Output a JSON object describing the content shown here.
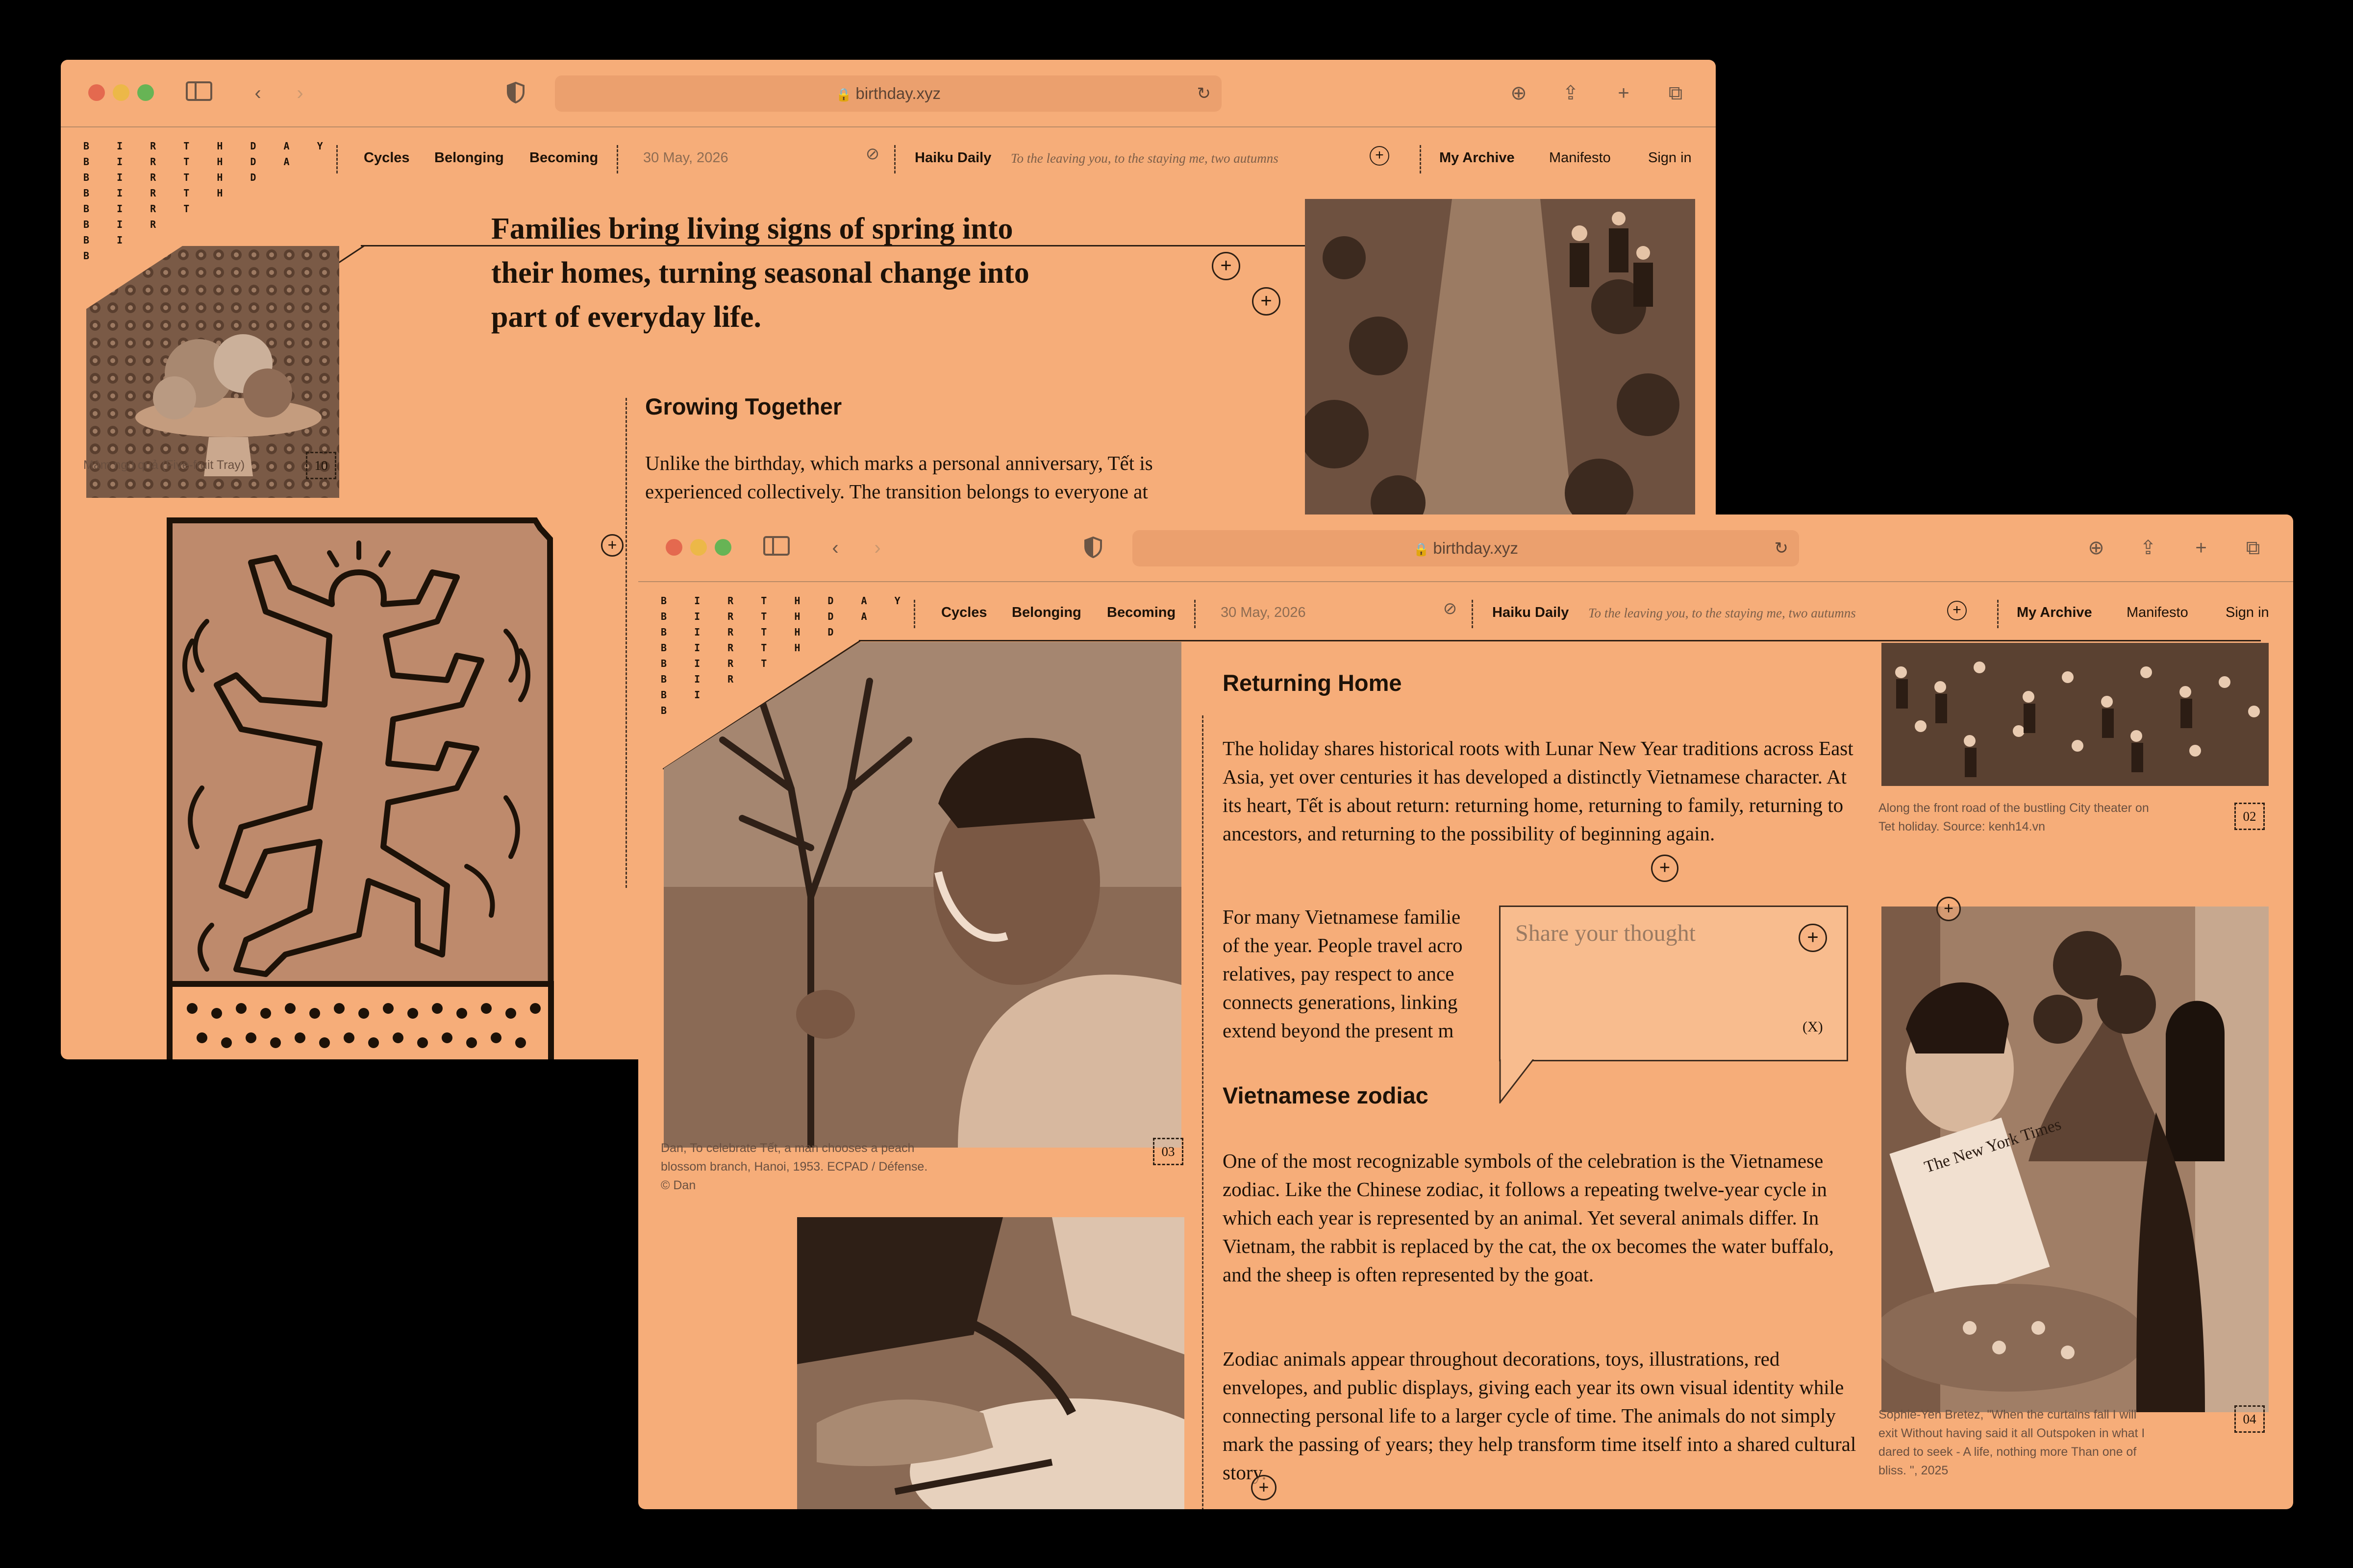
{
  "colors": {
    "page_bg": "#f6ad79",
    "ink": "#1d1208",
    "outer_bg": "#000000"
  },
  "browser": {
    "url": "birthday.xyz"
  },
  "logo": {
    "rows": [
      "B I R T H D A Y",
      "B I R T H D A",
      "B I R T H D",
      "B I R T H",
      "B I R T",
      "B I R",
      "B I",
      "B"
    ]
  },
  "nav": {
    "links": [
      "Cycles",
      "Belonging",
      "Becoming"
    ],
    "date": "30 May, 2026",
    "haiku_label": "Haiku Daily",
    "haiku_text": "To the leaving you, to the staying me, two autumns",
    "archive": "My Archive",
    "manifesto": "Manifesto",
    "signin": "Sign in"
  },
  "window1": {
    "headline": "Families bring living signs of spring into their homes, turning seasonal change into part of everyday life.",
    "section_title": "Growing Together",
    "section_text": "Unlike the birthday, which marks a personal anniversary, Tết is experienced collectively. The transition belongs to everyone at",
    "fruit_caption": "Mâm ngũ quả (Five-fruit Tray)",
    "fruit_num": "10"
  },
  "window2": {
    "returning_title": "Returning Home",
    "returning_p1": "The holiday shares historical roots with Lunar New Year traditions across East Asia, yet over centuries it has developed a distinctly Vietnamese character. At its heart, Tết is about return: returning home, returning to family, returning to ancestors, and returning to the possibility of beginning again.",
    "returning_p2_lines": [
      "For many Vietnamese familie",
      "of the year. People travel acro",
      "relatives, pay respect to ance",
      "connects generations, linking",
      "extend beyond the present m"
    ],
    "zodiac_title": "Vietnamese zodiac",
    "zodiac_p1": "One of the most recognizable symbols of the celebration is the Vietnamese zodiac. Like the Chinese zodiac, it follows a repeating twelve-year cycle in which each year is represented by an animal. Yet several animals differ. In Vietnam, the rabbit is replaced by the cat, the ox becomes the water buffalo, and the sheep is often represented by the goat.",
    "zodiac_p2": "Zodiac animals appear throughout decorations, toys, illustrations, red envelopes, and public displays, giving each year its own visual identity while connecting personal life to a larger cycle of time. The animals do not simply mark the passing of years; they help transform time itself into a shared cultural story.",
    "thought_placeholder": "Share your thought",
    "thought_close": "(X)",
    "man_caption": "Dan, To celebrate Tết, a man chooses a peach blossom branch, Hanoi, 1953. ECPAD / Défense. © Dan",
    "man_num": "03",
    "street_caption": "Along the front road of the bustling City theater on Tet holiday. Source: kenh14.vn",
    "street_num": "02",
    "art_caption": "Sophie-Yen Bretez, \"When the curtains fall I will exit Without having said it all Outspoken in what I dared to seek - A life, nothing more Than one of bliss. \", 2025",
    "art_num": "04",
    "newspaper_text": "The New York Times"
  }
}
